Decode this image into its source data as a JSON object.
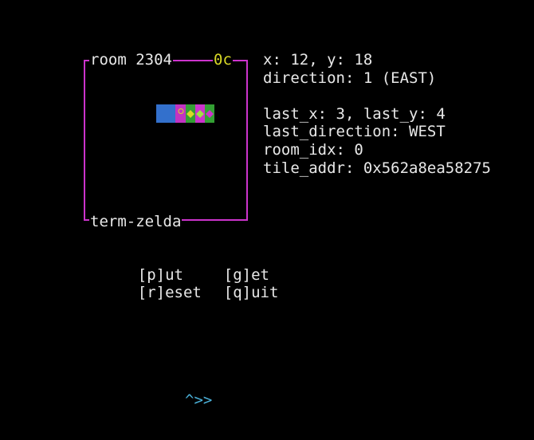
{
  "room": {
    "title": "room 2304",
    "code": "0c",
    "footer": "term-zelda",
    "frame_color": "#cc33cc",
    "code_color": "#d8d826",
    "tiles": [
      {
        "color": "#3370cc",
        "icon": "blue-tile"
      },
      {
        "color": "#3370cc",
        "icon": "blue-tile"
      },
      {
        "color": "#c233c2",
        "icon": "ring-icon"
      },
      {
        "color": "#33a033",
        "icon": "gem-icon"
      },
      {
        "color": "#cc33cc",
        "icon": "gem-icon"
      },
      {
        "color": "#33a033",
        "icon": "gem-icon"
      }
    ]
  },
  "info": {
    "line1": "x: 12, y: 18",
    "line2": "direction: 1 (EAST)",
    "line3": "",
    "line4": "last_x: 3, last_y: 4",
    "line5": "last_direction: WEST",
    "line6": "room_idx: 0",
    "line7": "tile_addr: 0x562a8ea58275"
  },
  "menu": {
    "put": "[p]ut",
    "get": "[g]et",
    "reset": "[r]eset",
    "quit": "[q]uit"
  },
  "prompt": "^>>",
  "colors": {
    "background": "#000000",
    "text": "#e8e8e8",
    "prompt": "#4ab0d8"
  }
}
